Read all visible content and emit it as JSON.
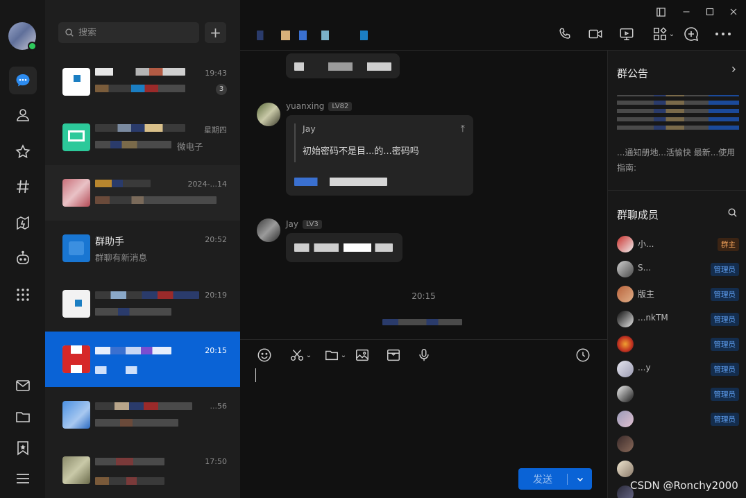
{
  "colors": {
    "accent": "#0a63d6",
    "online": "#2ec95c",
    "owner_role": "#f0a15a",
    "admin_role": "#5e9ef0"
  },
  "nav": {
    "items": [
      "messages-icon",
      "contacts-icon",
      "favorites-icon",
      "channels-icon",
      "games-icon",
      "bot-icon",
      "apps-icon",
      "mail-icon",
      "folder-icon",
      "bookmark-icon",
      "menu-icon"
    ]
  },
  "list": {
    "search_placeholder": "搜索",
    "add_label": "+",
    "conversations": [
      {
        "name": "",
        "time": "19:43",
        "preview": "",
        "badge": "3"
      },
      {
        "name": "",
        "time": "星期四",
        "preview": "微电子"
      },
      {
        "name": "",
        "time": "2024-...14",
        "preview": ""
      },
      {
        "name": "群助手",
        "time": "20:52",
        "preview": "群聊有新消息"
      },
      {
        "name": "",
        "time": "20:19",
        "preview": ""
      },
      {
        "name": "",
        "time": "20:15",
        "preview": ""
      },
      {
        "name": "",
        "time": "...56",
        "preview": ""
      },
      {
        "name": "",
        "time": "17:50",
        "preview": ""
      }
    ]
  },
  "chat": {
    "header_icons": [
      "phone-icon",
      "video-icon",
      "screen-share-icon",
      "apps-grid-icon",
      "add-chat-icon",
      "more-icon"
    ],
    "messages": [
      {
        "sender": "yuanxing",
        "level": "LV82",
        "quote_sender": "Jay",
        "quote_text": "初始密码不是目...的...密码吗"
      },
      {
        "sender": "Jay",
        "level": "LV3",
        "text": ""
      }
    ],
    "time_separator": "20:15",
    "toolbar": [
      "emoji-icon",
      "scissors-icon",
      "folder-icon",
      "image-icon",
      "screenshot-icon",
      "mic-icon",
      "history-icon"
    ],
    "send_label": "发送"
  },
  "right": {
    "announce_title": "群公告",
    "announce_text": "...通知册地...活愉快 最新...使用指南:",
    "members_title": "群聊成员",
    "members": [
      {
        "name": "小...",
        "role": "群主"
      },
      {
        "name": "S...",
        "role": "管理员"
      },
      {
        "name": "版主",
        "role": "管理员"
      },
      {
        "name": "...nkTM",
        "role": "管理员"
      },
      {
        "name": "",
        "role": "管理员"
      },
      {
        "name": "...y",
        "role": "管理员"
      },
      {
        "name": "",
        "role": "管理员"
      },
      {
        "name": "",
        "role": "管理员"
      },
      {
        "name": "",
        "role": ""
      },
      {
        "name": "",
        "role": ""
      },
      {
        "name": "",
        "role": ""
      }
    ]
  },
  "watermark": "CSDN @Ronchy2000"
}
